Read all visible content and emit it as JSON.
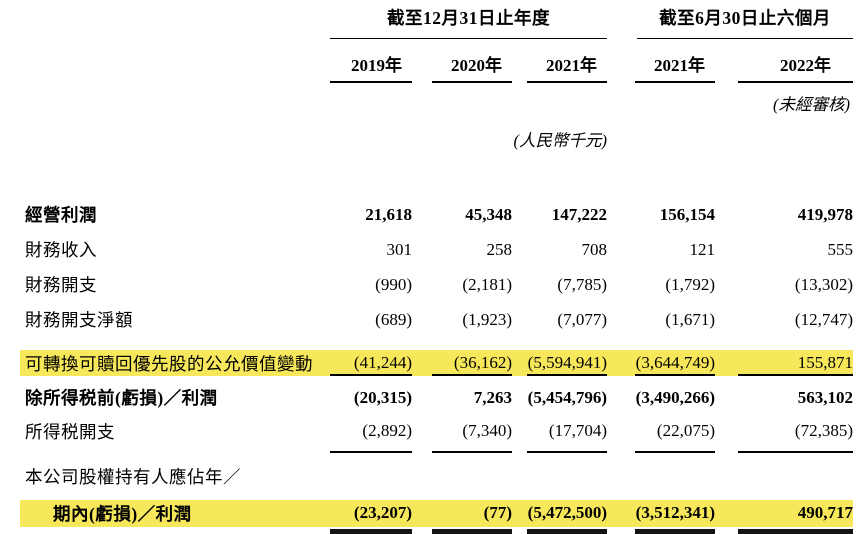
{
  "table": {
    "highlight_color": "#f7e75a",
    "col_groups": [
      {
        "label": "截至12月31日止年度",
        "years": [
          "2019年",
          "2020年",
          "2021年"
        ]
      },
      {
        "label": "截至6月30日止六個月",
        "years": [
          "2021年",
          "2022年"
        ]
      }
    ],
    "unaudited_note": "(未經審核)",
    "currency_note": "(人民幣千元)",
    "rows": [
      {
        "label": "經營利潤",
        "values": [
          "21,618",
          "45,348",
          "147,222",
          "156,154",
          "419,978"
        ]
      },
      {
        "label": "財務收入",
        "values": [
          "301",
          "258",
          "708",
          "121",
          "555"
        ]
      },
      {
        "label": "財務開支",
        "values": [
          "(990)",
          "(2,181)",
          "(7,785)",
          "(1,792)",
          "(13,302)"
        ]
      },
      {
        "label": "財務開支淨額",
        "values": [
          "(689)",
          "(1,923)",
          "(7,077)",
          "(1,671)",
          "(12,747)"
        ]
      },
      {
        "label": "可轉換可贖回優先股的公允價值變動",
        "values": [
          "(41,244)",
          "(36,162)",
          "(5,594,941)",
          "(3,644,749)",
          "155,871"
        ]
      },
      {
        "label": "除所得税前(虧損)／利潤",
        "values": [
          "(20,315)",
          "7,263",
          "(5,454,796)",
          "(3,490,266)",
          "563,102"
        ]
      },
      {
        "label": "所得税開支",
        "values": [
          "(2,892)",
          "(7,340)",
          "(17,704)",
          "(22,075)",
          "(72,385)"
        ]
      },
      {
        "label": "本公司股權持有人應佔年／"
      },
      {
        "label": "期內(虧損)／利潤",
        "values": [
          "(23,207)",
          "(77)",
          "(5,472,500)",
          "(3,512,341)",
          "490,717"
        ]
      }
    ]
  }
}
